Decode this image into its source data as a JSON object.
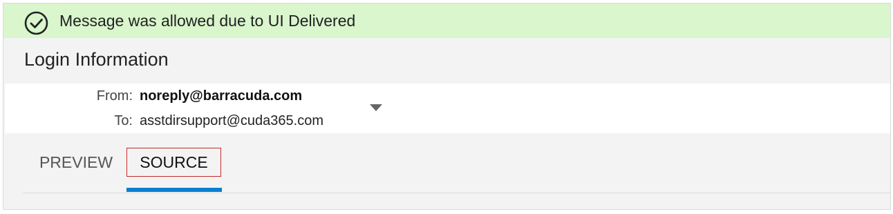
{
  "banner": {
    "icon": "check-circle-icon",
    "message": "Message was allowed due to UI Delivered",
    "background": "#d9f6cc"
  },
  "message": {
    "subject": "Login Information",
    "from_label": "From:",
    "from_value": "noreply@barracuda.com",
    "to_label": "To:",
    "to_value": "asstdirsupport@cuda365.com",
    "expand_icon": "caret-down-icon"
  },
  "tabs": [
    {
      "label": "PREVIEW",
      "selected": false
    },
    {
      "label": "SOURCE",
      "selected": true
    }
  ],
  "colors": {
    "accent": "#0a7fd0",
    "focus_outline": "#c62828"
  }
}
